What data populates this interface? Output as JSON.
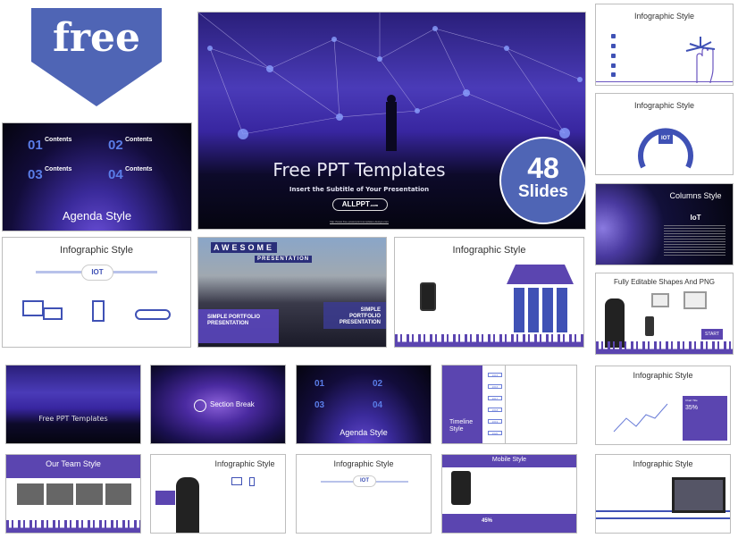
{
  "badge_free": {
    "label": "free",
    "color": "#4f65b5"
  },
  "badge_slides": {
    "count": "48",
    "label": "Slides",
    "color": "#4f65b5"
  },
  "main_slide": {
    "title": "Free PPT Templates",
    "subtitle": "Insert the Subtitle of Your Presentation",
    "logo": "ALLPPT",
    "logo_suffix": ".com",
    "url": "http://www.free-powerpoint-templates-design.com"
  },
  "agenda": {
    "title": "Agenda Style",
    "items": [
      {
        "num": "01",
        "label": "Contents"
      },
      {
        "num": "02",
        "label": "Contents"
      },
      {
        "num": "03",
        "label": "Contents"
      },
      {
        "num": "04",
        "label": "Contents"
      }
    ]
  },
  "right_col": [
    {
      "title": "Infographic Style"
    },
    {
      "title": "Infographic Style",
      "center": "IOT"
    },
    {
      "title": "Columns Style",
      "logo": "IoT"
    },
    {
      "title": "Fully Editable Shapes And PNG",
      "button": "START"
    }
  ],
  "row2": [
    {
      "title": "Infographic Style",
      "center": "IOT"
    },
    {
      "title1": "AWESOME",
      "title2": "PRESENTATION",
      "left_text": "SIMPLE PORTFOLIO PRESENTATION",
      "right_text": "SIMPLE PORTFOLIO PRESENTATION"
    },
    {
      "title": "Infographic Style"
    }
  ],
  "row3": [
    {
      "title": "Free PPT Templates"
    },
    {
      "title": "Section Break"
    },
    {
      "title": "Agenda Style",
      "items": [
        "01",
        "02",
        "03",
        "04"
      ]
    },
    {
      "title": "Timeline Style",
      "years": [
        "2015",
        "2016",
        "2017",
        "2018",
        "2019",
        "2020"
      ]
    },
    {
      "title": "Infographic Style",
      "stat": "35%",
      "chart_title": "Chart Title"
    }
  ],
  "row4": [
    {
      "title": "Our Team Style"
    },
    {
      "title": "Infographic Style"
    },
    {
      "title": "Infographic Style",
      "center": "IOT"
    },
    {
      "title": "Mobile Style",
      "stat": "45%"
    },
    {
      "title": "Infographic Style"
    }
  ]
}
